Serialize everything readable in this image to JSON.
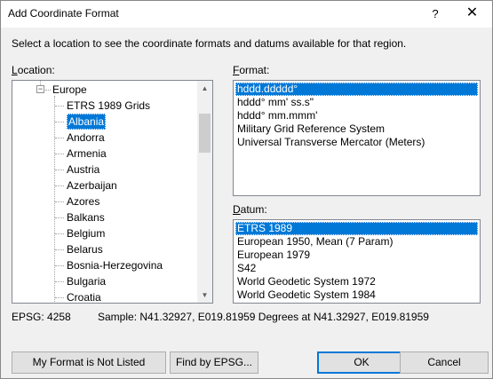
{
  "window": {
    "title": "Add Coordinate Format",
    "help_glyph": "?",
    "close_glyph": "✕"
  },
  "instruction": "Select a location to see the coordinate formats and datums available for that region.",
  "location": {
    "label": "Location:",
    "label_underline": "L",
    "label_rest": "ocation:",
    "tree": {
      "parent": "Europe",
      "children": [
        "ETRS 1989 Grids",
        "Albania",
        "Andorra",
        "Armenia",
        "Austria",
        "Azerbaijan",
        "Azores",
        "Balkans",
        "Belgium",
        "Belarus",
        "Bosnia-Herzegovina",
        "Bulgaria",
        "Croatia"
      ],
      "selected": "Albania"
    }
  },
  "format": {
    "label_underline": "F",
    "label_rest": "ormat:",
    "items": [
      "hddd.ddddd°",
      "hddd° mm' ss.s\"",
      "hddd° mm.mmm'",
      "Military Grid Reference System",
      "Universal Transverse Mercator (Meters)"
    ],
    "selected": "hddd.ddddd°"
  },
  "datum": {
    "label_underline": "D",
    "label_rest": "atum:",
    "items": [
      "ETRS 1989",
      "European 1950, Mean (7 Param)",
      "European 1979",
      "S42",
      "World Geodetic System 1972",
      "World Geodetic System 1984"
    ],
    "selected": "ETRS 1989"
  },
  "footer": {
    "epsg": "EPSG: 4258",
    "sample": "Sample: N41.32927, E019.81959 Degrees at N41.32927, E019.81959"
  },
  "buttons": {
    "not_listed": "My Format is Not Listed",
    "find_epsg": "Find by EPSG...",
    "ok": "OK",
    "cancel": "Cancel"
  },
  "colors": {
    "selection": "#0078d7",
    "dialog_bg": "#f0f0f0"
  }
}
